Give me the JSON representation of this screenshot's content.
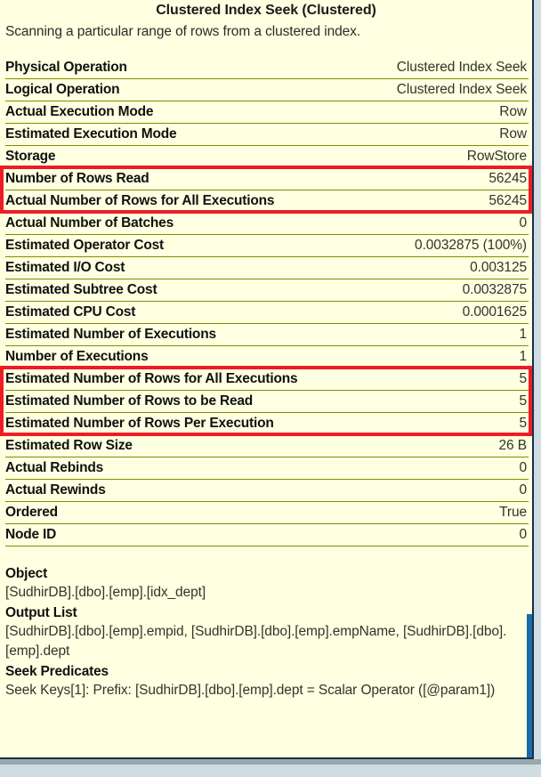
{
  "tooltip": {
    "title": "Clustered Index Seek (Clustered)",
    "description": "Scanning a particular range of rows from a clustered index.",
    "properties": [
      {
        "key": "Physical Operation",
        "value": "Clustered Index Seek"
      },
      {
        "key": "Logical Operation",
        "value": "Clustered Index Seek"
      },
      {
        "key": "Actual Execution Mode",
        "value": "Row"
      },
      {
        "key": "Estimated Execution Mode",
        "value": "Row"
      },
      {
        "key": "Storage",
        "value": "RowStore"
      },
      {
        "key": "Number of Rows Read",
        "value": "56245"
      },
      {
        "key": "Actual Number of Rows for All Executions",
        "value": "56245"
      },
      {
        "key": "Actual Number of Batches",
        "value": "0"
      },
      {
        "key": "Estimated Operator Cost",
        "value": "0.0032875 (100%)"
      },
      {
        "key": "Estimated I/O Cost",
        "value": "0.003125"
      },
      {
        "key": "Estimated Subtree Cost",
        "value": "0.0032875"
      },
      {
        "key": "Estimated CPU Cost",
        "value": "0.0001625"
      },
      {
        "key": "Estimated Number of Executions",
        "value": "1"
      },
      {
        "key": "Number of Executions",
        "value": "1"
      },
      {
        "key": "Estimated Number of Rows for All Executions",
        "value": "5"
      },
      {
        "key": "Estimated Number of Rows to be Read",
        "value": "5"
      },
      {
        "key": "Estimated Number of Rows Per Execution",
        "value": "5"
      },
      {
        "key": "Estimated Row Size",
        "value": "26 B"
      },
      {
        "key": "Actual Rebinds",
        "value": "0"
      },
      {
        "key": "Actual Rewinds",
        "value": "0"
      },
      {
        "key": "Ordered",
        "value": "True"
      },
      {
        "key": "Node ID",
        "value": "0"
      }
    ],
    "highlights": [
      {
        "name": "actual-rows-highlight",
        "start_index": 5,
        "row_count": 2,
        "color": "#ee1c25"
      },
      {
        "name": "estimated-rows-highlight",
        "start_index": 14,
        "row_count": 3,
        "color": "#ee1c25"
      }
    ],
    "sections": [
      {
        "heading": "Object",
        "body": "[SudhirDB].[dbo].[emp].[idx_dept]"
      },
      {
        "heading": "Output List",
        "body": "[SudhirDB].[dbo].[emp].empid, [SudhirDB].[dbo].[emp].empName, [SudhirDB].[dbo].[emp].dept"
      },
      {
        "heading": "Seek Predicates",
        "body": "Seek Keys[1]: Prefix: [SudhirDB].[dbo].[emp].dept = Scalar Operator ([@param1])"
      }
    ]
  }
}
